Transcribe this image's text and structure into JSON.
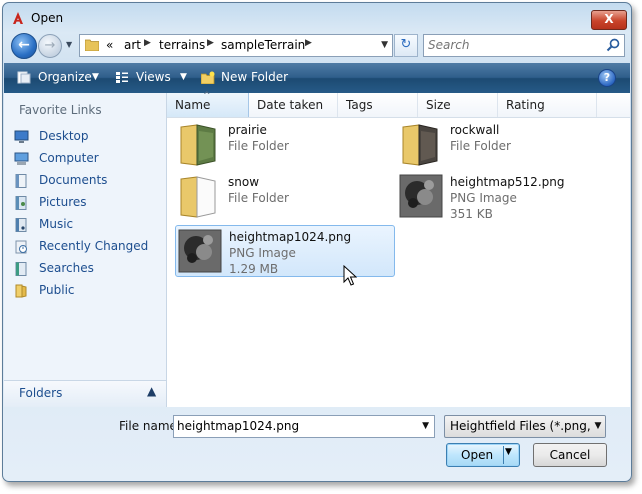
{
  "window": {
    "title": "Open",
    "close_glyph": "X"
  },
  "nav": {
    "back_glyph": "←",
    "forward_glyph": "→",
    "breadcrumb": [
      "art",
      "terrains",
      "sampleTerrain"
    ],
    "breadcrumb_prefix": "«",
    "search_placeholder": "Search"
  },
  "toolbar": {
    "organize_label": "Organize",
    "views_label": "Views",
    "new_folder_label": "New Folder",
    "help_glyph": "?"
  },
  "sidebar": {
    "header": "Favorite Links",
    "items": [
      {
        "label": "Desktop",
        "icon": "desktop-icon"
      },
      {
        "label": "Computer",
        "icon": "computer-icon"
      },
      {
        "label": "Documents",
        "icon": "documents-icon"
      },
      {
        "label": "Pictures",
        "icon": "pictures-icon"
      },
      {
        "label": "Music",
        "icon": "music-icon"
      },
      {
        "label": "Recently Changed",
        "icon": "recently-changed-icon"
      },
      {
        "label": "Searches",
        "icon": "searches-icon"
      },
      {
        "label": "Public",
        "icon": "public-folder-icon"
      }
    ],
    "folders_label": "Folders"
  },
  "columns": [
    "Name",
    "Date taken",
    "Tags",
    "Size",
    "Rating"
  ],
  "files": [
    {
      "name": "prairie",
      "type": "File Folder",
      "size": "",
      "kind": "folder"
    },
    {
      "name": "rockwall",
      "type": "File Folder",
      "size": "",
      "kind": "folder"
    },
    {
      "name": "snow",
      "type": "File Folder",
      "size": "",
      "kind": "folder"
    },
    {
      "name": "heightmap512.png",
      "type": "PNG Image",
      "size": "351 KB",
      "kind": "image"
    },
    {
      "name": "heightmap1024.png",
      "type": "PNG Image",
      "size": "1.29 MB",
      "kind": "image",
      "selected": true
    }
  ],
  "bottom": {
    "file_name_label": "File name:",
    "file_name_value": "heightmap1024.png",
    "file_type": "Heightfield Files (*.png, *.bmp",
    "open_label": "Open",
    "cancel_label": "Cancel"
  },
  "colors": {
    "accent": "#2f5e8b",
    "link": "#1d4e8f",
    "selection": "#d2e7fb"
  }
}
